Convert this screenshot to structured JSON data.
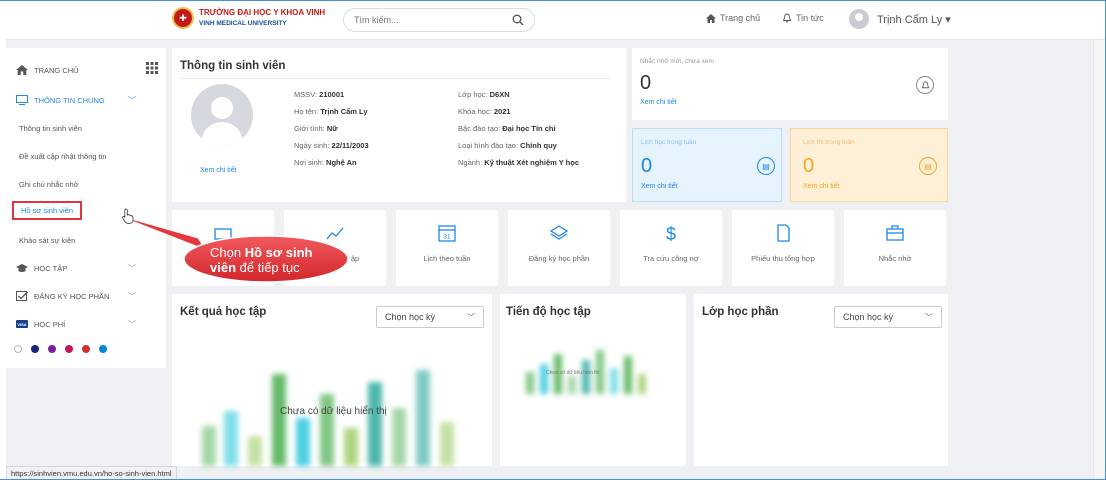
{
  "header": {
    "logo_line1": "TRƯỜNG ĐẠI HỌC Y KHOA VINH",
    "logo_line2": "VINH MEDICAL UNIVERSITY",
    "search_placeholder": "Tìm kiếm...",
    "nav_home": "Trang chủ",
    "nav_news": "Tin tức",
    "user_name": "Trịnh Cẩm Ly ▾"
  },
  "sidebar": {
    "home": "TRANG CHỦ",
    "general": "THÔNG TIN CHUNG",
    "sub_items": [
      "Thông tin sinh viên",
      "Đề xuất cập nhật thông tin",
      "Ghi chú nhắc nhở",
      "Hồ sơ sinh viên",
      "Khảo sát sự kiện"
    ],
    "study": "HỌC TẬP",
    "register": "ĐĂNG KÝ HỌC PHẦN",
    "fee": "HỌC PHÍ",
    "theme_colors": [
      "#ffffff",
      "#1a237e",
      "#7b1fa2",
      "#c2185b",
      "#d32f2f",
      "#0288d1"
    ]
  },
  "student": {
    "title": "Thông tin sinh viên",
    "view_detail": "Xem chi tiết",
    "left": [
      {
        "label": "MSSV:",
        "value": "210001"
      },
      {
        "label": "Họ tên:",
        "value": "Trịnh Cẩm Ly"
      },
      {
        "label": "Giới tính:",
        "value": "Nữ"
      },
      {
        "label": "Ngày sinh:",
        "value": "22/11/2003"
      },
      {
        "label": "Nơi sinh:",
        "value": "Nghệ An"
      }
    ],
    "right": [
      {
        "label": "Lớp học:",
        "value": "D6XN"
      },
      {
        "label": "Khóa học:",
        "value": "2021"
      },
      {
        "label": "Bậc đào tạo:",
        "value": "Đại học Tín chỉ"
      },
      {
        "label": "Loại hình đào tạo:",
        "value": "Chính quy"
      },
      {
        "label": "Ngành:",
        "value": "Kỹ thuật Xét nghiệm Y học"
      }
    ]
  },
  "reminders": {
    "label": "Nhắc nhở mới, chưa xem",
    "count": "0",
    "link": "Xem chi tiết"
  },
  "week_schedule": {
    "label": "Lịch học trong tuần",
    "count": "0",
    "link": "Xem chi tiết",
    "color": "#1e88e5"
  },
  "week_exams": {
    "label": "Lịch thi trong tuần",
    "count": "0",
    "link": "Xem chi tiết",
    "color": "#f5a623"
  },
  "tiles": [
    "",
    "ập",
    "Lịch theo tuần",
    "Đăng ký học phần",
    "Tra cứu công nợ",
    "Phiếu thu tổng hợp",
    "Nhắc nhở"
  ],
  "results": {
    "title": "Kết quả học tập",
    "select": "Chọn học kỳ",
    "empty": "Chưa có dữ liệu hiển thị"
  },
  "progress": {
    "title": "Tiến độ học tập",
    "empty": "Chưa có dữ liệu hiển thị"
  },
  "classes": {
    "title": "Lớp học phần",
    "select": "Chọn học kỳ"
  },
  "callout": {
    "prefix": "Chọn ",
    "bold": "Hồ sơ sinh",
    "bold2": "viên",
    "suffix": " để tiếp tục"
  },
  "status_url": "https://sinhvien.vmu.edu.vn/ho-so-sinh-vien.html"
}
